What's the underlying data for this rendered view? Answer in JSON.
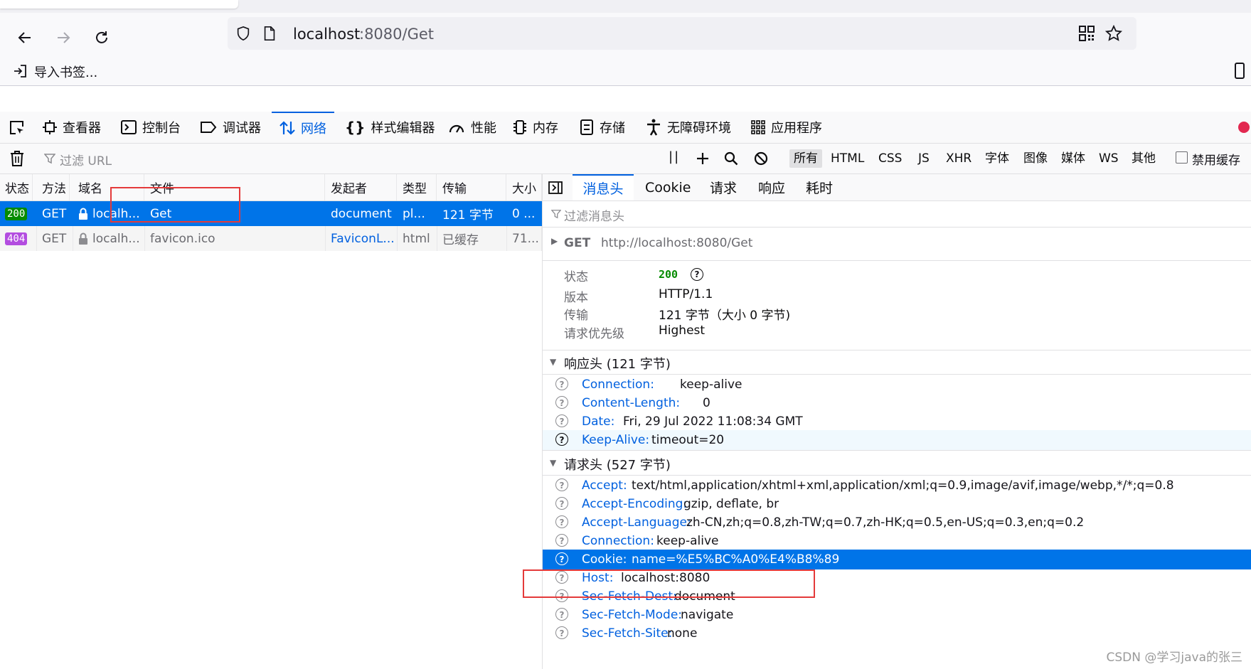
{
  "browser": {
    "url_host": "localhost",
    "url_rest": ":8080/Get",
    "bookmarks_label": "导入书签..."
  },
  "devtools": {
    "tabs": [
      {
        "label": "查看器",
        "icon": "inspector-icon"
      },
      {
        "label": "控制台",
        "icon": "console-icon"
      },
      {
        "label": "调试器",
        "icon": "debugger-icon"
      },
      {
        "label": "网络",
        "icon": "network-arrows-icon",
        "active": true
      },
      {
        "label": "样式编辑器",
        "icon": "braces-icon"
      },
      {
        "label": "性能",
        "icon": "gauge-icon"
      },
      {
        "label": "内存",
        "icon": "chip-icon"
      },
      {
        "label": "存储",
        "icon": "storage-icon"
      },
      {
        "label": "无障碍环境",
        "icon": "accessibility-icon"
      },
      {
        "label": "应用程序",
        "icon": "grid-icon"
      }
    ],
    "toolbar": {
      "filter_url_placeholder": "过滤 URL",
      "type_filters": [
        "所有",
        "HTML",
        "CSS",
        "JS",
        "XHR",
        "字体",
        "图像",
        "媒体",
        "WS",
        "其他"
      ],
      "disable_cache_label": "禁用缓存"
    }
  },
  "requests": {
    "columns": [
      "状态",
      "方法",
      "域名",
      "文件",
      "发起者",
      "类型",
      "传输",
      "大小"
    ],
    "rows": [
      {
        "status": "200",
        "method": "GET",
        "domain": "localh...",
        "file": "Get",
        "initiator": "document",
        "type": "pl...",
        "transfer": "121 字节",
        "size": "0 ..."
      },
      {
        "status": "404",
        "method": "GET",
        "domain": "localh...",
        "file": "favicon.ico",
        "initiator": "FaviconL...",
        "type": "html",
        "transfer": "已缓存",
        "size": "71..."
      }
    ]
  },
  "details": {
    "tabs": [
      "消息头",
      "Cookie",
      "请求",
      "响应",
      "耗时"
    ],
    "filter_placeholder": "过滤消息头",
    "request_line": {
      "method": "GET",
      "url": "http://localhost:8080/Get"
    },
    "summary": [
      {
        "label": "状态",
        "value": "200"
      },
      {
        "label": "版本",
        "value": "HTTP/1.1"
      },
      {
        "label": "传输",
        "value": "121 字节（大小 0 字节)"
      },
      {
        "label": "请求优先级",
        "value": "Highest"
      }
    ],
    "response_headers_title": "响应头 (121 字节)",
    "response_headers": [
      {
        "key": "Connection:",
        "value": "keep-alive"
      },
      {
        "key": "Content-Length:",
        "value": "0"
      },
      {
        "key": "Date:",
        "value": "Fri, 29 Jul 2022 11:08:34 GMT"
      },
      {
        "key": "Keep-Alive:",
        "value": "timeout=20"
      }
    ],
    "request_headers_title": "请求头 (527 字节)",
    "request_headers": [
      {
        "key": "Accept:",
        "value": "text/html,application/xhtml+xml,application/xml;q=0.9,image/avif,image/webp,*/*;q=0.8"
      },
      {
        "key": "Accept-Encoding:",
        "value": "gzip, deflate, br"
      },
      {
        "key": "Accept-Language:",
        "value": "zh-CN,zh;q=0.8,zh-TW;q=0.7,zh-HK;q=0.5,en-US;q=0.3,en;q=0.2"
      },
      {
        "key": "Connection:",
        "value": "keep-alive"
      },
      {
        "key": "Cookie:",
        "value": "name=%E5%BC%A0%E4%B8%89"
      },
      {
        "key": "Host:",
        "value": "localhost:8080"
      },
      {
        "key": "Sec-Fetch-Dest:",
        "value": "document"
      },
      {
        "key": "Sec-Fetch-Mode:",
        "value": "navigate"
      },
      {
        "key": "Sec-Fetch-Site:",
        "value": "none"
      }
    ]
  },
  "watermark": "CSDN @学习java的张三",
  "colors": {
    "accent": "#0060df",
    "selected_row": "#0074e8",
    "status_ok": "#058b00",
    "status_404": "#b34de0",
    "annotation": "#e43a3a"
  }
}
